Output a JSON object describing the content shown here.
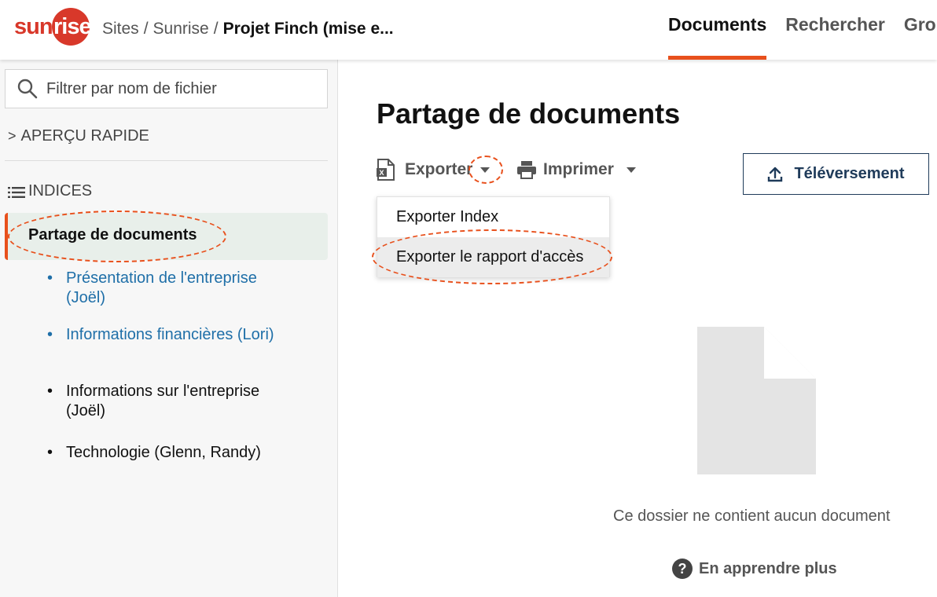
{
  "header": {
    "logo_left": "sun",
    "logo_right": "rise",
    "breadcrumb": {
      "items": [
        "Sites",
        "Sunrise"
      ],
      "separator": "/",
      "current": "Projet Finch (mise e..."
    },
    "tabs": [
      {
        "label": "Documents",
        "active": true
      },
      {
        "label": "Rechercher",
        "active": false
      },
      {
        "label": "Grou",
        "active": false
      }
    ]
  },
  "sidebar": {
    "search": {
      "placeholder": "Filtrer par nom de fichier",
      "value": ""
    },
    "quick_view": {
      "chevron": ">",
      "label": "APERÇU RAPIDE"
    },
    "indices": {
      "label": "INDICES"
    },
    "active_item": "Partage de documents",
    "items": [
      {
        "label": "Présentation de l'entreprise (Joël)",
        "style": "link"
      },
      {
        "label": "Informations financières (Lori)",
        "style": "link"
      },
      {
        "label": "Informations sur l'entreprise (Joël)",
        "style": "plain"
      },
      {
        "label": "Technologie (Glenn, Randy)",
        "style": "plain"
      }
    ],
    "bullet": "•"
  },
  "main": {
    "title": "Partage de documents",
    "export_label": "Exporter",
    "print_label": "Imprimer",
    "upload_label": "Téléversement",
    "dropdown": {
      "options": [
        "Exporter Index",
        "Exporter le rapport d'accès"
      ],
      "hovered_index": 1
    },
    "empty_message": "Ce dossier ne contient aucun document",
    "learn_more": "En apprendre plus",
    "help_glyph": "?"
  },
  "colors": {
    "accent": "#e8501c",
    "brand": "#d8382a",
    "link": "#1f6fa8",
    "upload_border": "#1f3b5a"
  }
}
